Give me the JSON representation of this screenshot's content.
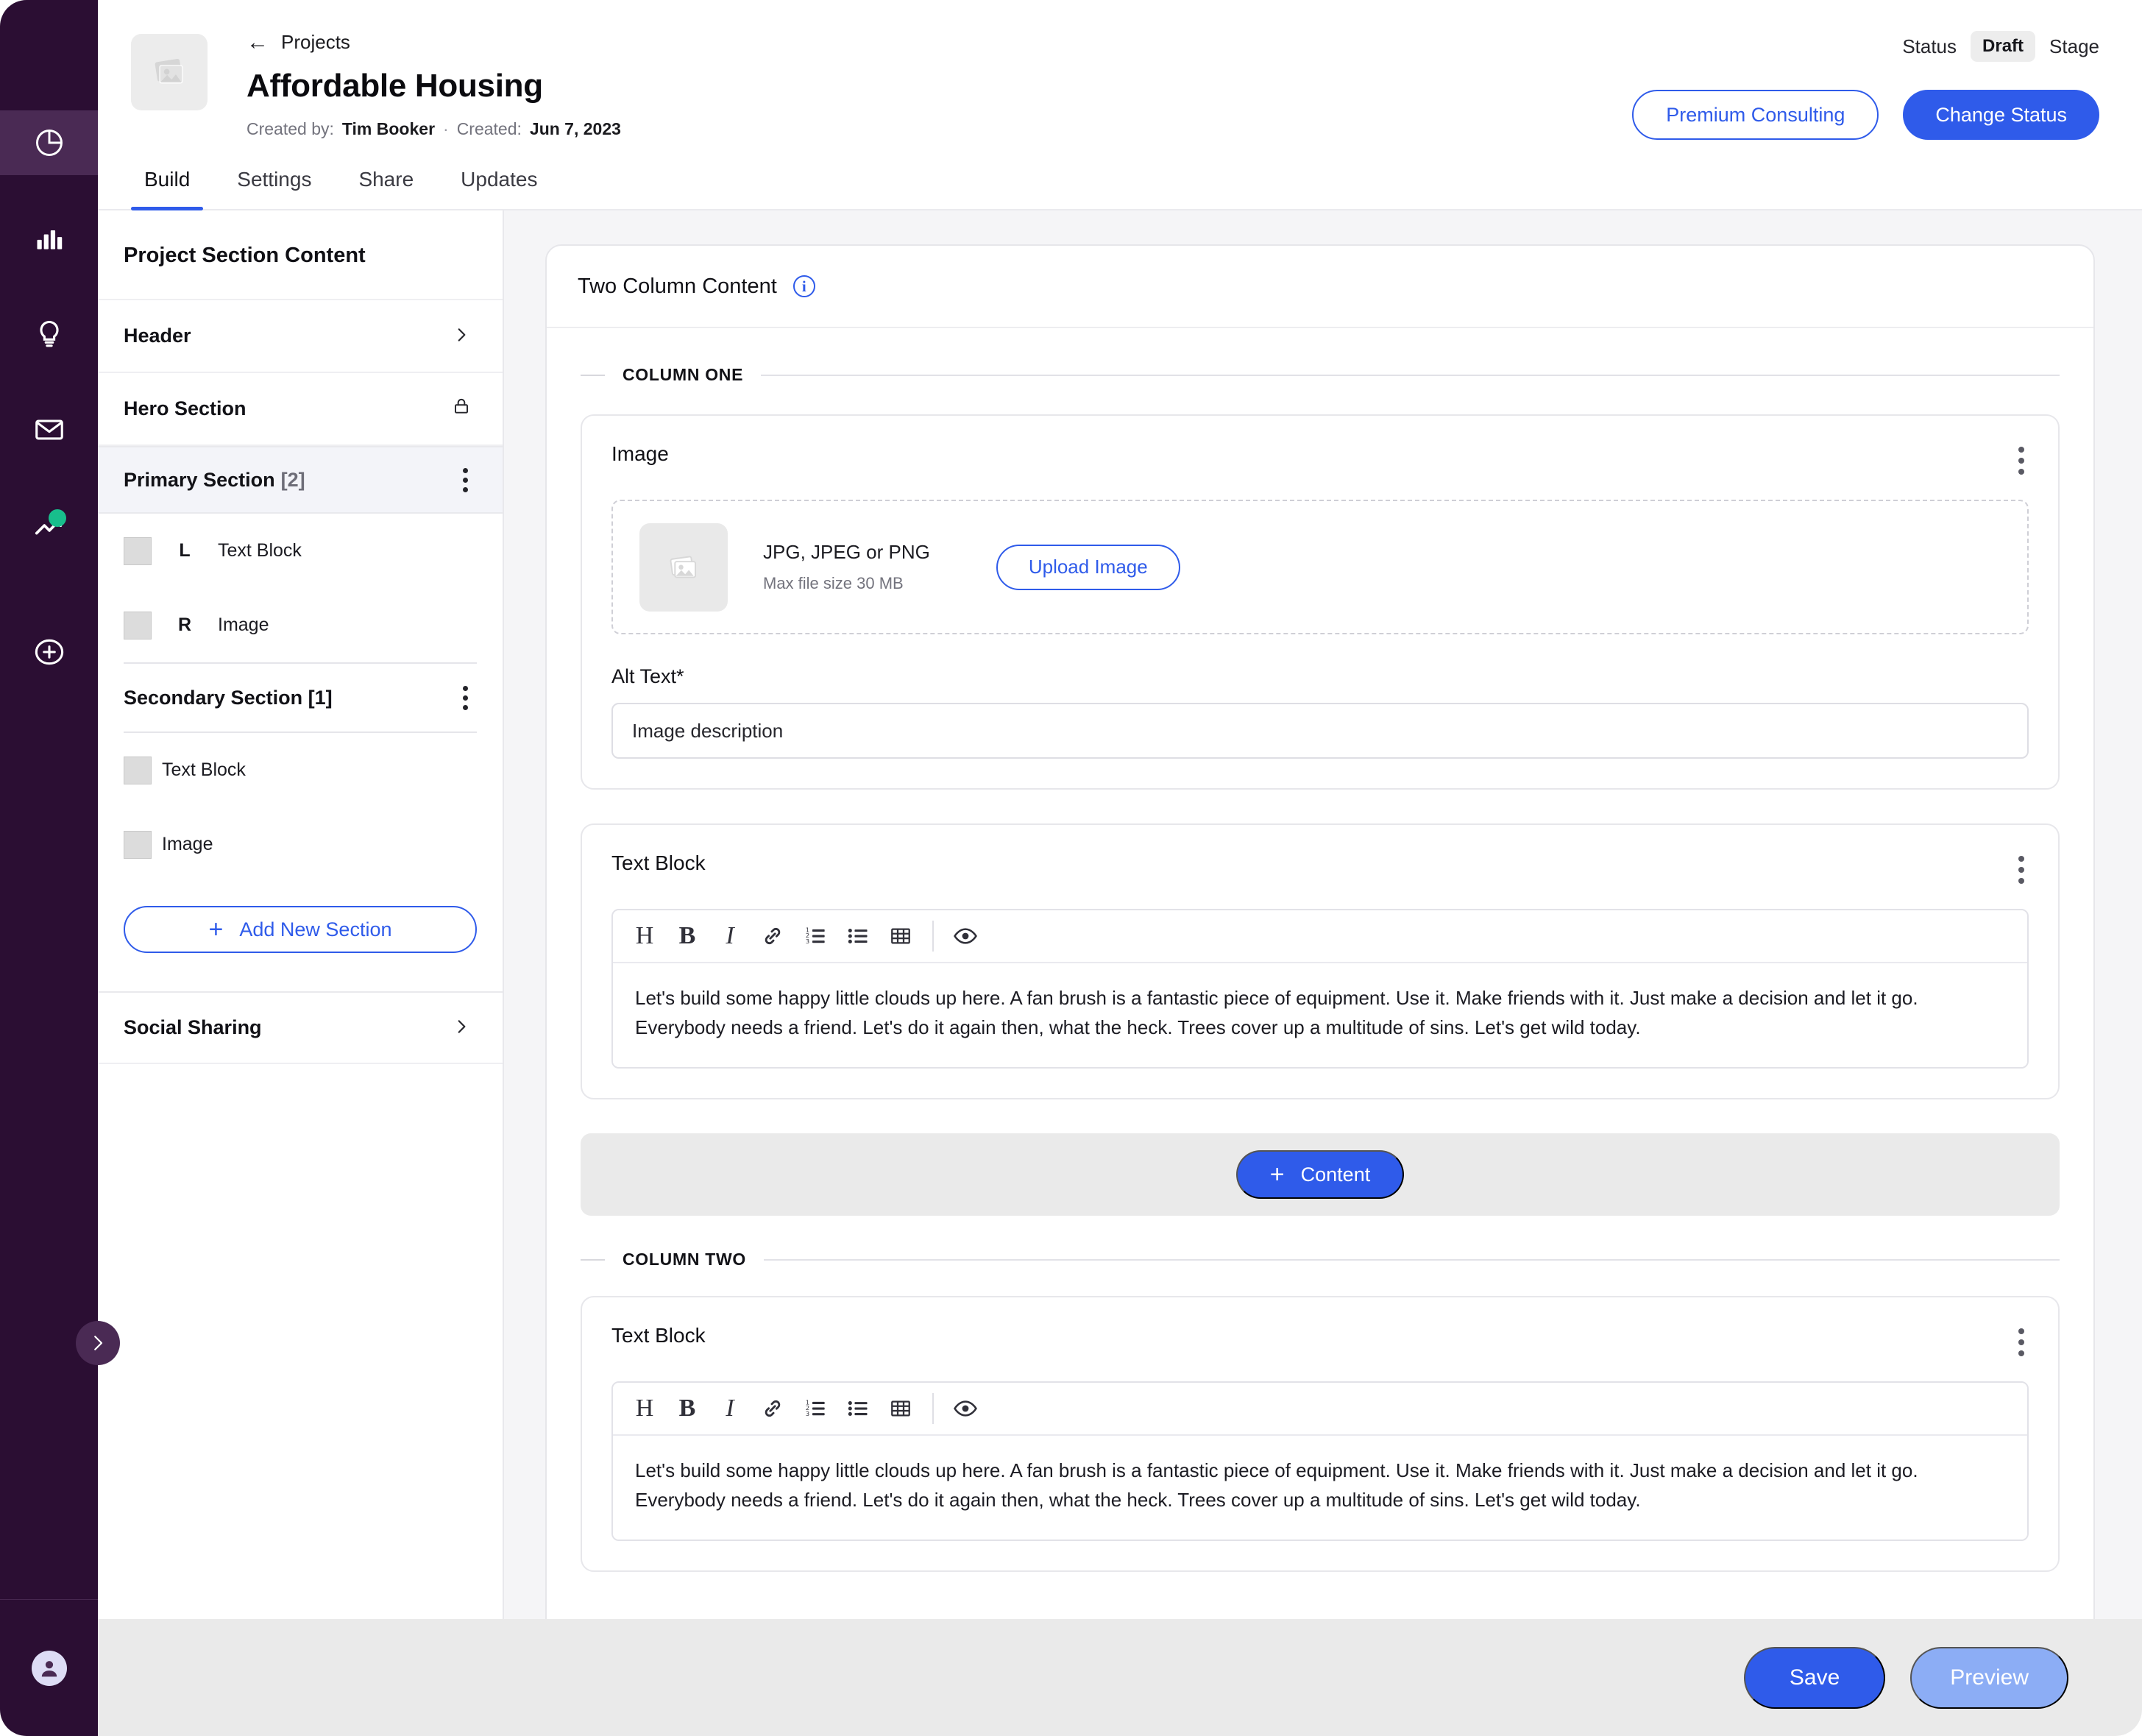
{
  "rail": {
    "items": [
      {
        "name": "pie-chart-icon",
        "active": true,
        "badge": false
      },
      {
        "name": "bar-chart-icon",
        "active": false,
        "badge": false
      },
      {
        "name": "lightbulb-icon",
        "active": false,
        "badge": false
      },
      {
        "name": "mail-icon",
        "active": false,
        "badge": false
      },
      {
        "name": "trending-up-icon",
        "active": false,
        "badge": true
      }
    ],
    "add_item": {
      "name": "add-circle-icon"
    },
    "avatar": {
      "name": "user-avatar"
    },
    "expand": {
      "name": "expand-rail-chevron"
    }
  },
  "header": {
    "breadcrumb": "Projects",
    "title": "Affordable Housing",
    "created_by_label": "Created by:",
    "created_by_value": "Tim Booker",
    "separator": "·",
    "created_label": "Created:",
    "created_value": "Jun 7, 2023",
    "status_label": "Status",
    "status_value": "Draft",
    "stage_label": "Stage",
    "premium_button": "Premium Consulting",
    "change_status_button": "Change Status"
  },
  "tabs": [
    {
      "label": "Build",
      "active": true
    },
    {
      "label": "Settings",
      "active": false
    },
    {
      "label": "Share",
      "active": false
    },
    {
      "label": "Updates",
      "active": false
    }
  ],
  "section_panel": {
    "title": "Project Section Content",
    "header_row": {
      "label": "Header"
    },
    "hero_row": {
      "label": "Hero Section"
    },
    "primary_group": {
      "label": "Primary Section",
      "count": "[2]",
      "children": [
        {
          "position": "L",
          "label": "Text Block"
        },
        {
          "position": "R",
          "label": "Image"
        }
      ]
    },
    "secondary_group": {
      "label": "Secondary Section [1]",
      "children": [
        {
          "position": "",
          "label": "Text Block"
        },
        {
          "position": "",
          "label": "Image"
        }
      ]
    },
    "add_section_button": "Add New Section",
    "social_row": {
      "label": "Social Sharing"
    }
  },
  "editor": {
    "card_title": "Two Column Content",
    "column_one_label": "COLUMN ONE",
    "column_two_label": "COLUMN TWO",
    "image_block": {
      "title": "Image",
      "formats": "JPG, JPEG or PNG",
      "max_size": "Max file size 30 MB",
      "upload_button": "Upload Image",
      "alt_label": "Alt Text*",
      "alt_placeholder": "Image description",
      "alt_value": ""
    },
    "text_block_one": {
      "title": "Text Block",
      "content": "Let's build some happy little clouds up here. A fan brush is a fantastic piece of equipment. Use it. Make friends with it. Just make a decision and let it go. Everybody needs a friend. Let's do it again then, what the heck. Trees cover up a multitude of sins. Let's get wild today."
    },
    "text_block_two": {
      "title": "Text Block",
      "content": "Let's build some happy little clouds up here. A fan brush is a fantastic piece of equipment. Use it. Make friends with it. Just make a decision and let it go. Everybody needs a friend. Let's do it again then, what the heck. Trees cover up a multitude of sins. Let's get wild today."
    },
    "add_content_button": "Content",
    "toolbar": [
      {
        "glyph": "H",
        "name": "heading-icon"
      },
      {
        "glyph": "B",
        "name": "bold-icon"
      },
      {
        "glyph": "I",
        "name": "italic-icon"
      },
      {
        "glyph": "link",
        "name": "link-icon"
      },
      {
        "glyph": "ol",
        "name": "ordered-list-icon"
      },
      {
        "glyph": "ul",
        "name": "bullet-list-icon"
      },
      {
        "glyph": "table",
        "name": "table-icon"
      },
      {
        "glyph": "eye",
        "name": "preview-eye-icon"
      }
    ]
  },
  "footer": {
    "save_button": "Save",
    "preview_button": "Preview"
  },
  "colors": {
    "rail_bg": "#2B0E33",
    "rail_active": "#4A2A54",
    "accent_blue": "#2F5BEA",
    "preview_blue": "#8CADF5",
    "badge_green": "#18BE8C",
    "canvas_bg": "#F5F5F7",
    "footer_bg": "#EAEAEA"
  }
}
